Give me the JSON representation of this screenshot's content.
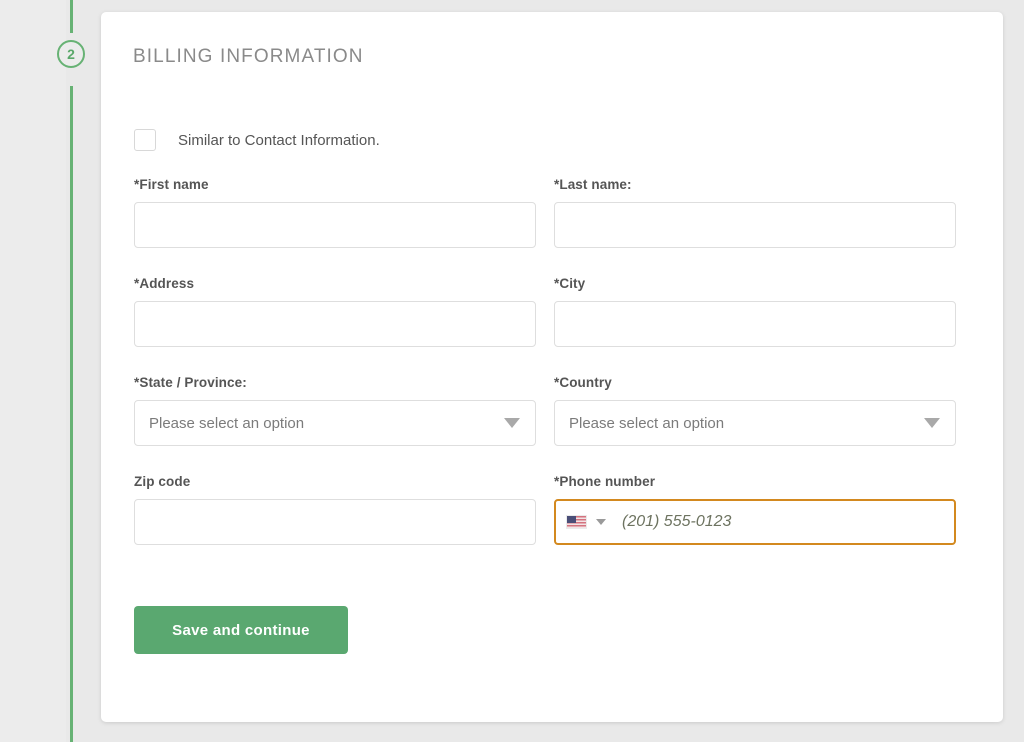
{
  "step": {
    "number": "2"
  },
  "card": {
    "title": "BILLING INFORMATION"
  },
  "similar": {
    "label": "Similar to Contact Information.",
    "checked": false
  },
  "fields": {
    "first_name": {
      "label": "*First name",
      "value": "",
      "placeholder": ""
    },
    "last_name": {
      "label": "*Last name:",
      "value": "",
      "placeholder": ""
    },
    "address": {
      "label": "*Address",
      "value": "",
      "placeholder": ""
    },
    "city": {
      "label": "*City",
      "value": "",
      "placeholder": ""
    },
    "state": {
      "label": "*State / Province:",
      "selected": "Please select an option"
    },
    "country": {
      "label": "*Country",
      "selected": "Please select an option"
    },
    "zip": {
      "label": "Zip code",
      "value": "",
      "placeholder": ""
    },
    "phone": {
      "label": "*Phone number",
      "value": "",
      "placeholder": "(201) 555-0123",
      "country_flag": "us-flag-icon"
    }
  },
  "actions": {
    "save_label": "Save and continue"
  },
  "colors": {
    "accent_green": "#5aa870",
    "timeline_green": "#67b274",
    "warning_orange": "#d3891f",
    "page_background": "#e9e9e9",
    "card_background": "#ffffff",
    "label_text": "#555555",
    "title_text": "#8a8a8a",
    "input_border": "#dedede"
  }
}
